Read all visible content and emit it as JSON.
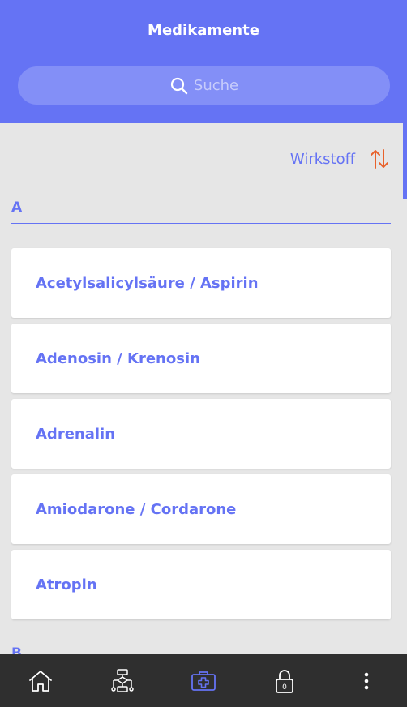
{
  "header": {
    "title": "Medikamente",
    "search_placeholder": "Suche"
  },
  "sort": {
    "label": "Wirkstoff"
  },
  "sections": [
    {
      "letter": "A",
      "items": [
        {
          "label": "Acetylsalicylsäure / Aspirin"
        },
        {
          "label": "Adenosin / Krenosin"
        },
        {
          "label": "Adrenalin"
        },
        {
          "label": "Amiodarone / Cordarone"
        },
        {
          "label": "Atropin"
        }
      ]
    },
    {
      "letter": "B"
    }
  ],
  "bottom_nav": {
    "items": [
      {
        "icon": "home-icon"
      },
      {
        "icon": "algorithm-icon"
      },
      {
        "icon": "medical-kit-icon",
        "active": true
      },
      {
        "icon": "lock-icon",
        "badge": "0"
      },
      {
        "icon": "more-vertical-icon"
      }
    ]
  },
  "colors": {
    "accent": "#6573f4",
    "sort_icon": "#e8622c",
    "nav_background": "#2f2f2f"
  }
}
